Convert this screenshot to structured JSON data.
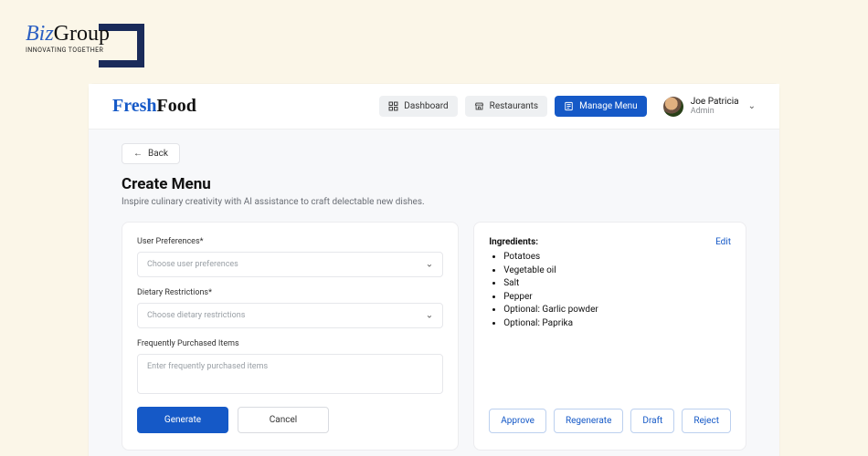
{
  "outer_logo": {
    "biz": "Biz",
    "group": "Group",
    "tagline": "INNOVATING TOGETHER"
  },
  "app": {
    "brand_fresh": "Fresh",
    "brand_food": "Food",
    "nav": {
      "dashboard": "Dashboard",
      "restaurants": "Restaurants",
      "manage_menu": "Manage Menu"
    },
    "user": {
      "name": "Joe Patricia",
      "role": "Admin"
    }
  },
  "page": {
    "back_label": "Back",
    "title": "Create Menu",
    "subtitle": "Inspire culinary creativity with AI assistance to craft delectable new dishes."
  },
  "form": {
    "user_pref_label": "User Preferences*",
    "user_pref_placeholder": "Choose user preferences",
    "diet_label": "Dietary Restrictions*",
    "diet_placeholder": "Choose dietary restrictions",
    "freq_label": "Frequently Purchased Items",
    "freq_placeholder": "Enter frequently purchased items",
    "generate": "Generate",
    "cancel": "Cancel"
  },
  "result": {
    "title": "Ingredients:",
    "edit": "Edit",
    "items": [
      "Potatoes",
      "Vegetable oil",
      "Salt",
      "Pepper",
      "Optional: Garlic powder",
      "Optional: Paprika"
    ],
    "actions": {
      "approve": "Approve",
      "regenerate": "Regenerate",
      "draft": "Draft",
      "reject": "Reject"
    }
  }
}
